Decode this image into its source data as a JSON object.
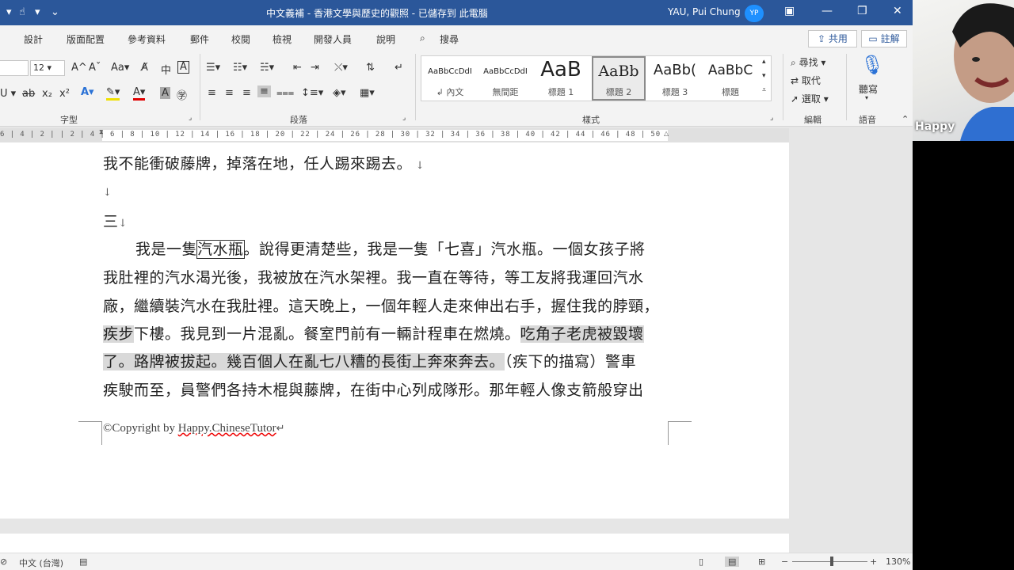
{
  "titlebar": {
    "title": "中文義補 - 香港文學與歷史的觀照 - 已儲存到 此電腦",
    "user_name": "YAU, Pui Chung",
    "avatar_initials": "YP"
  },
  "menu": {
    "tabs": [
      "設計",
      "版面配置",
      "參考資料",
      "郵件",
      "校閱",
      "檢視",
      "開發人員",
      "說明"
    ],
    "search_label": "搜尋",
    "share_label": "共用",
    "comment_label": "註解"
  },
  "ribbon": {
    "font_name": "",
    "font_size": "12",
    "font_group_label": "字型",
    "paragraph_group_label": "段落",
    "styles_group_label": "樣式",
    "editing_group_label": "編輯",
    "voice_group_label": "語音",
    "styles": [
      {
        "sample": "AaBbCcDdI",
        "name": "↲ 內文"
      },
      {
        "sample": "AaBbCcDdI",
        "name": "無間距"
      },
      {
        "sample": "AaB",
        "name": "標題 1"
      },
      {
        "sample": "AaBb",
        "name": "標題 2"
      },
      {
        "sample": "AaBb(",
        "name": "標題 3"
      },
      {
        "sample": "AaBbC",
        "name": "標題"
      }
    ],
    "find_label": "尋找",
    "replace_label": "取代",
    "select_label": "選取",
    "dictate_label": "聽寫"
  },
  "ruler": {
    "numbers": "6 | 4 | 2 |    | 2 | 4 | 6 | 8 | 10 | 12 | 14 | 16 | 18 | 20 | 22 | 24 | 26 | 28 | 30 | 32 | 34 | 36 | 38 | 40 |    42 | 44 | 46 | 48 | 50"
  },
  "document": {
    "line1": "我不能衝破藤牌，掉落在地，任人踢來踢去。",
    "line2": "",
    "line3": "三",
    "para": {
      "l1_a": "我是一隻",
      "l1_box": "汽水瓶",
      "l1_b": "。說得更清楚些，我是一隻「七喜」汽水瓶。一個女孩子將",
      "l2": "我肚裡的汽水渴光後，我被放在汽水架裡。我一直在等待，等工友將我運回汽水",
      "l3": "廠，繼續裝汽水在我肚裡。這天晚上，一個年輕人走來伸出右手，握住我的脖頸，",
      "l4_hl1": "疾步",
      "l4_mid": "下樓。我見到一片混亂。餐室門前有一輛計程車在燃燒。",
      "l4_hl2": "吃角子老虎被毀壞",
      "l5_hl": "了。路牌被拔起。幾百個人在亂七八糟的長街上奔來奔去。",
      "l5_b": "（疾下的描寫）警車",
      "l6": "疾駛而至，員警們各持木棍與藤牌，在街中心列成隊形。那年輕人像支箭般穿出"
    },
    "footer_prefix": "©Copyright by ",
    "footer_link": "Happy.ChineseTutor"
  },
  "statusbar": {
    "language": "中文 (台灣)",
    "zoom": "130%"
  },
  "webcam": {
    "name": "Happy"
  }
}
